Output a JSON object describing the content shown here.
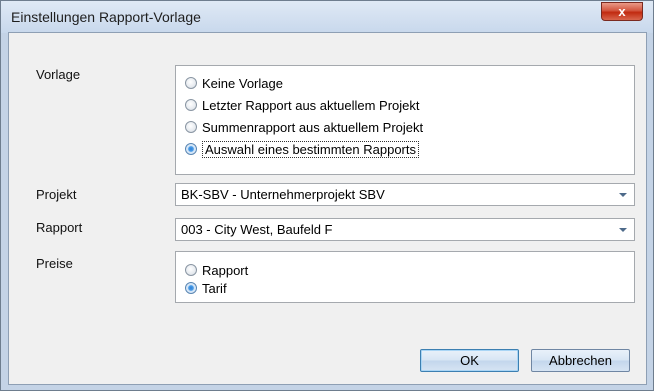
{
  "window": {
    "title": "Einstellungen Rapport-Vorlage",
    "close_glyph": "x"
  },
  "vorlage": {
    "label": "Vorlage",
    "options": [
      {
        "label": "Keine Vorlage",
        "checked": false
      },
      {
        "label": "Letzter Rapport aus aktuellem Projekt",
        "checked": false
      },
      {
        "label": "Summenrapport aus aktuellem Projekt",
        "checked": false
      },
      {
        "label": "Auswahl eines bestimmten Rapports",
        "checked": true
      }
    ]
  },
  "projekt": {
    "label": "Projekt",
    "value": "BK-SBV - Unternehmerprojekt SBV"
  },
  "rapport": {
    "label": "Rapport",
    "value": "003 - City West, Baufeld F"
  },
  "preise": {
    "label": "Preise",
    "options": [
      {
        "label": "Rapport",
        "checked": false
      },
      {
        "label": "Tarif",
        "checked": true
      }
    ]
  },
  "buttons": {
    "ok": "OK",
    "cancel": "Abbrechen"
  }
}
